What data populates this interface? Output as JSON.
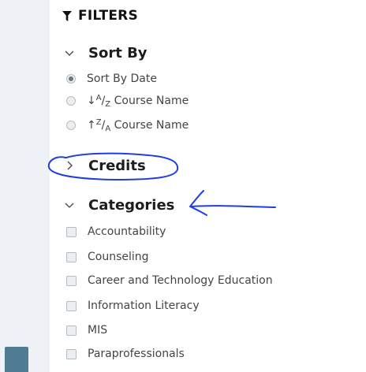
{
  "filters": {
    "title": "FILTERS",
    "icon": "funnel-icon"
  },
  "sort_by": {
    "title": "Sort By",
    "expanded": true,
    "options": [
      {
        "label": "Sort By Date",
        "checked": true
      },
      {
        "arrow": "↓",
        "sup": "A",
        "slash": "/",
        "sub": "Z",
        "text": " Course Name",
        "checked": false
      },
      {
        "arrow": "↑",
        "sup": "Z",
        "slash": "/",
        "sub": "A",
        "text": " Course Name",
        "checked": false
      }
    ]
  },
  "credits": {
    "title": "Credits",
    "expanded": false
  },
  "categories": {
    "title": "Categories",
    "expanded": true,
    "items": [
      "Accountability",
      "Counseling",
      "Career and Technology Education",
      "Information Literacy",
      "MIS",
      "Paraprofessionals"
    ]
  },
  "colors": {
    "annotation": "#1f3fe0",
    "left_tab": "#4f7b93",
    "left_strip": "#eef2f6"
  }
}
